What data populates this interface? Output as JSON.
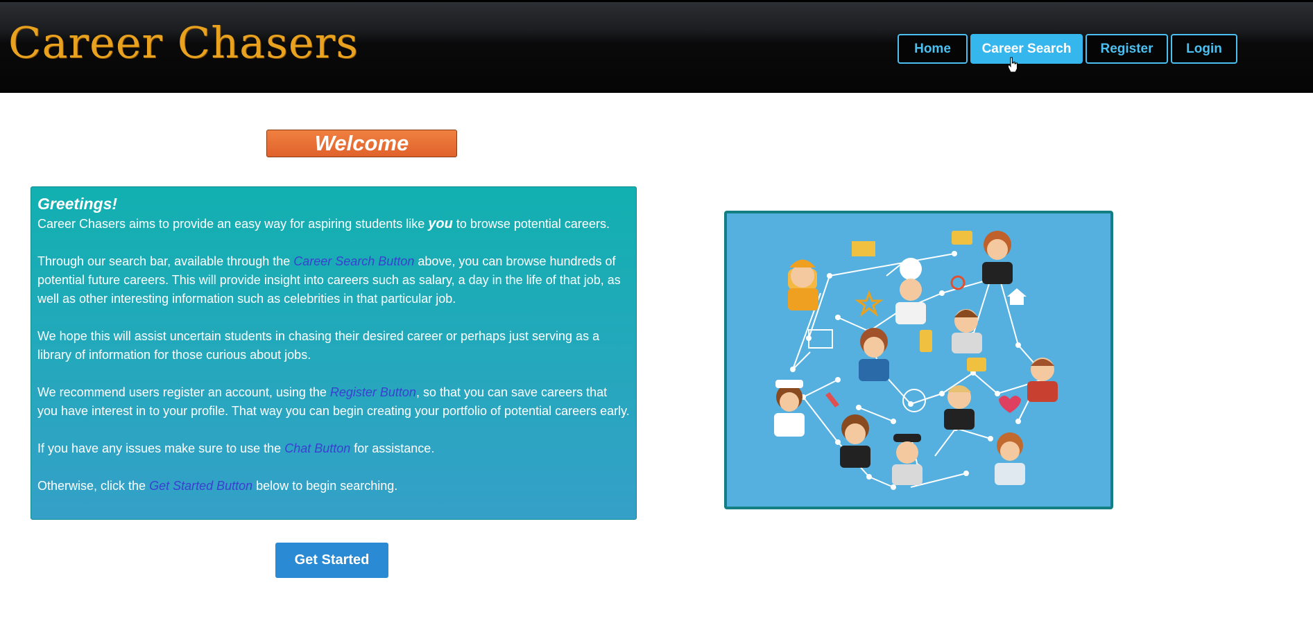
{
  "app": {
    "logo_text": "Career Chasers"
  },
  "nav": {
    "home": "Home",
    "career_search": "Career Search",
    "register": "Register",
    "login": "Login"
  },
  "welcome": {
    "label": "Welcome"
  },
  "card": {
    "heading": "Greetings!",
    "p1_before": "Career Chasers aims to provide an easy way for aspiring students like ",
    "p1_em": "you",
    "p1_after": " to browse potential careers.",
    "p2_before": "Through our search bar, available through the ",
    "p2_link": "Career Search Button",
    "p2_after": " above, you can browse hundreds of potential future careers. This will provide insight into careers such as salary, a day in the life of that job, as well as other interesting information such as celebrities in that particular job.",
    "p3": "We hope this will assist uncertain students in chasing their desired career or perhaps just serving as a library of information for those curious about jobs.",
    "p4_before": "We recommend users register an account, using the ",
    "p4_link": "Register Button",
    "p4_after": ", so that you can save careers that you have interest in to your profile. That way you can begin creating your portfolio of potential careers early.",
    "p5_before": "If you have any issues make sure to use the ",
    "p5_link": "Chat Button",
    "p5_after": " for assistance.",
    "p6_before": "Otherwise, click the ",
    "p6_link": "Get Started Button",
    "p6_after": " below to begin searching."
  },
  "get_started": {
    "label": "Get Started"
  },
  "colors": {
    "accent": "#35b6ec",
    "logo": "#e8a21f",
    "card": "#12b0b0",
    "button": "#2b8ad4",
    "illustration_bg": "#55b0e0"
  },
  "icons": [
    "careers-network-illustration",
    "pointer-cursor-icon"
  ]
}
